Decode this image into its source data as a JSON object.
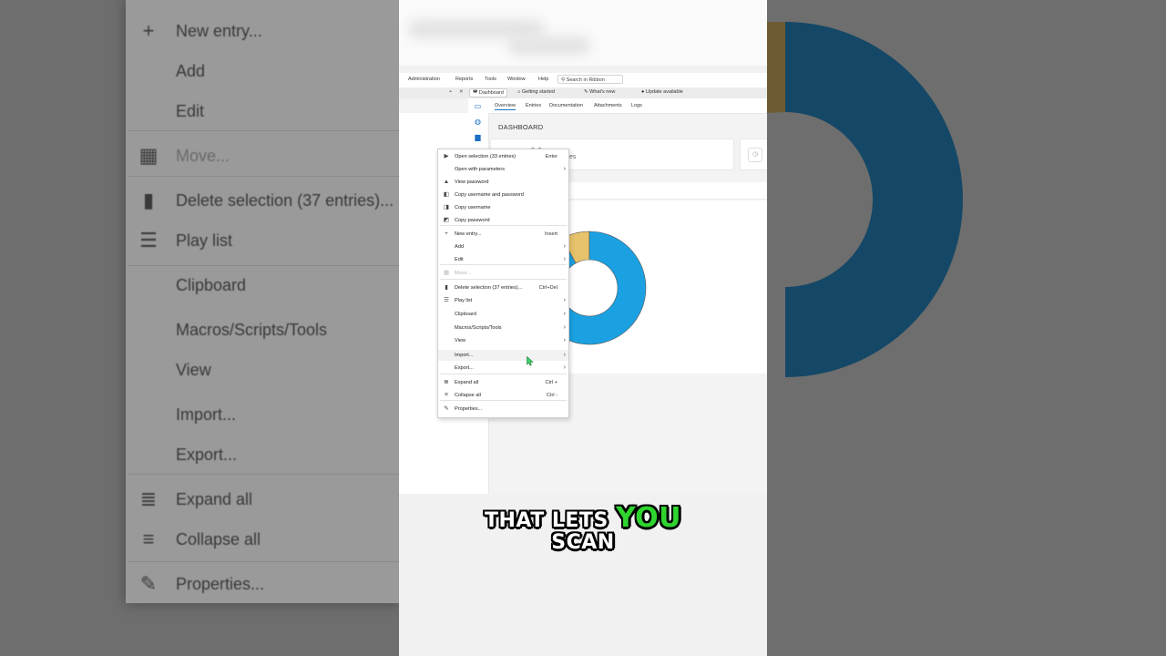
{
  "background_menu": {
    "items": [
      {
        "label": "New entry...",
        "icon": "plus-icon"
      },
      {
        "label": "Add",
        "icon": ""
      },
      {
        "label": "Edit",
        "icon": ""
      },
      {
        "label": "Move...",
        "icon": "move-icon"
      },
      {
        "label": "Delete selection (37 entries)...",
        "icon": "trash-icon"
      },
      {
        "label": "Play list",
        "icon": "list-icon"
      },
      {
        "label": "Clipboard",
        "icon": ""
      },
      {
        "label": "Macros/Scripts/Tools",
        "icon": ""
      },
      {
        "label": "View",
        "icon": ""
      },
      {
        "label": "Import...",
        "icon": ""
      },
      {
        "label": "Export...",
        "icon": ""
      },
      {
        "label": "Expand all",
        "icon": "expand-icon"
      },
      {
        "label": "Collapse all",
        "icon": "collapse-icon"
      },
      {
        "label": "Properties...",
        "icon": "pencil-icon"
      }
    ]
  },
  "menubar": {
    "items": [
      "Administration",
      "Reports",
      "Tools",
      "Window",
      "Help"
    ],
    "search_placeholder": "Search in Ribbon"
  },
  "tabs": {
    "dashboard": "Dashboard",
    "getting_started": "Getting started",
    "whats_new": "What's new",
    "update": "Update available"
  },
  "subtabs": [
    "Overview",
    "Entries",
    "Documentation",
    "Attachments",
    "Logs"
  ],
  "dashboard": {
    "title": "DASHBOARD",
    "card_value": "33",
    "card_label": "es"
  },
  "context_menu": {
    "items": [
      {
        "label": "Open selection (33 entries)",
        "shortcut": "Enter",
        "icon": "open-icon",
        "submenu": false,
        "disabled": false
      },
      {
        "label": "Open with parameters",
        "shortcut": "",
        "icon": "",
        "submenu": true,
        "disabled": false
      },
      {
        "label": "View password",
        "shortcut": "",
        "icon": "lock-icon",
        "submenu": false,
        "disabled": false
      },
      {
        "label": "Copy username and password",
        "shortcut": "",
        "icon": "copy-user-pass-icon",
        "submenu": false,
        "disabled": false
      },
      {
        "label": "Copy username",
        "shortcut": "",
        "icon": "copy-user-icon",
        "submenu": false,
        "disabled": false
      },
      {
        "label": "Copy password",
        "shortcut": "",
        "icon": "copy-password-icon",
        "submenu": false,
        "disabled": false
      },
      {
        "label": "New entry...",
        "shortcut": "Insert",
        "icon": "plus-icon",
        "submenu": false,
        "disabled": false
      },
      {
        "label": "Add",
        "shortcut": "",
        "icon": "",
        "submenu": true,
        "disabled": false
      },
      {
        "label": "Edit",
        "shortcut": "",
        "icon": "",
        "submenu": true,
        "disabled": false
      },
      {
        "label": "Move...",
        "shortcut": "",
        "icon": "move-icon",
        "submenu": false,
        "disabled": true
      },
      {
        "label": "Delete selection (37 entries)...",
        "shortcut": "Ctrl+Del",
        "icon": "trash-icon",
        "submenu": false,
        "disabled": false
      },
      {
        "label": "Play list",
        "shortcut": "",
        "icon": "list-icon",
        "submenu": true,
        "disabled": false
      },
      {
        "label": "Clipboard",
        "shortcut": "",
        "icon": "",
        "submenu": true,
        "disabled": false
      },
      {
        "label": "Macros/Scripts/Tools",
        "shortcut": "",
        "icon": "",
        "submenu": true,
        "disabled": false
      },
      {
        "label": "View",
        "shortcut": "",
        "icon": "",
        "submenu": true,
        "disabled": false
      },
      {
        "label": "Import...",
        "shortcut": "",
        "icon": "",
        "submenu": true,
        "disabled": false,
        "hover": true
      },
      {
        "label": "Export...",
        "shortcut": "",
        "icon": "",
        "submenu": true,
        "disabled": false
      },
      {
        "label": "Expand all",
        "shortcut": "Ctrl +",
        "icon": "expand-icon",
        "submenu": false,
        "disabled": false
      },
      {
        "label": "Collapse all",
        "shortcut": "Ctrl -",
        "icon": "collapse-icon",
        "submenu": false,
        "disabled": false
      },
      {
        "label": "Properties...",
        "shortcut": "",
        "icon": "pencil-icon",
        "submenu": false,
        "disabled": false
      }
    ]
  },
  "chart_data": {
    "type": "pie",
    "donut": true,
    "categories": [
      "",
      ""
    ],
    "values": [
      92,
      8
    ],
    "colors": [
      "#1ba1e2",
      "#e6c26b"
    ]
  },
  "caption": {
    "line1_white": "THAT LETS",
    "line1_green": "YOU",
    "line2": "SCAN"
  },
  "colors": {
    "accent": "#1a73c7",
    "donut_blue": "#1ba1e2",
    "donut_gold": "#e6c26b",
    "caption_green": "#2fd42f"
  }
}
